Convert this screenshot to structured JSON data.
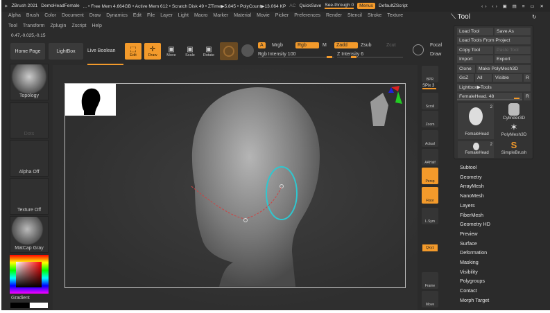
{
  "titlebar": {
    "app": "ZBrush 2021",
    "doc": "DemoHeadFemale",
    "stats": "... • Free Mem 4.664GB • Active Mem 612 • Scratch Disk 49 • ZTime▶5.845 • PolyCount▶13.064 KP",
    "ac": "AC",
    "quicksave": "QuickSave",
    "seethrough": "See-through  0",
    "menus": "Menus",
    "script": "DefaultZScript"
  },
  "menu_row1": [
    "Alpha",
    "Brush",
    "Color",
    "Document",
    "Draw",
    "Dynamics",
    "Edit",
    "File",
    "Layer",
    "Light",
    "Macro",
    "Marker",
    "Material",
    "Movie",
    "Picker",
    "Preferences",
    "Render",
    "Stencil",
    "Stroke",
    "Texture"
  ],
  "menu_row2": [
    "Tool",
    "Transform",
    "Zplugin",
    "Zscript",
    "Help"
  ],
  "coords": "0.47,-0.025,-0.15",
  "toolbar": {
    "home": "Home Page",
    "lightbox": "LightBox",
    "liveboolean": "Live Boolean",
    "edit": "Edit",
    "draw": "Draw",
    "move": "Move",
    "scale": "Scale",
    "rotate": "Rotate",
    "a": "A",
    "mrgb": "Mrgb",
    "rgb": "Rgb",
    "m": "M",
    "zadd": "Zadd",
    "zsub": "Zsub",
    "zcut": "Zcut",
    "rgb_intensity": "Rgb Intensity 100",
    "z_intensity": "Z Intensity 6",
    "focal": "Focal",
    "draw_size": "Draw"
  },
  "rgb_intensity_value": 100,
  "z_intensity_value": 6,
  "left_shelf": {
    "brush": "Topology",
    "stroke": "Dots",
    "alpha": "Alpha Off",
    "texture": "Texture Off",
    "material": "MatCap Gray",
    "gradient": "Gradient"
  },
  "right_shelf": [
    "BPR",
    "SPix 3",
    "Scroll",
    "Zoom",
    "Actual",
    "AAHalf",
    "Persp",
    "Floor",
    "L.Sym",
    "Frame",
    "Move"
  ],
  "right_shelf_extra": {
    "xyz": "Qxyz"
  },
  "tool_panel": {
    "title": "Tool",
    "load_tool": "Load Tool",
    "save_as": "Save As",
    "load_from_project": "Load Tools From Project",
    "copy_tool": "Copy Tool",
    "paste_tool": "Paste Tool",
    "import": "Import",
    "export": "Export",
    "clone": "Clone",
    "make_polymesh": "Make PolyMesh3D",
    "goz": "GoZ",
    "all": "All",
    "visible": "Visible",
    "r": "R",
    "lightbox_tools": "Lightbox▶Tools",
    "current_tool": "FemaleHead. 48",
    "thumbs": [
      {
        "label": "FemaleHead",
        "count": "2"
      },
      {
        "label": "Cylinder3D"
      },
      {
        "label": "PolyMesh3D"
      },
      {
        "label": "FemaleHead",
        "count": "2"
      },
      {
        "label": "SimpleBrush"
      }
    ]
  },
  "subpalettes": [
    "Subtool",
    "Geometry",
    "ArrayMesh",
    "NanoMesh",
    "Layers",
    "FiberMesh",
    "Geometry HD",
    "Preview",
    "Surface",
    "Deformation",
    "Masking",
    "Visibility",
    "Polygroups",
    "Contact",
    "Morph Target"
  ],
  "colors": {
    "accent": "#f39a2b",
    "bg": "#2b2b2b"
  }
}
